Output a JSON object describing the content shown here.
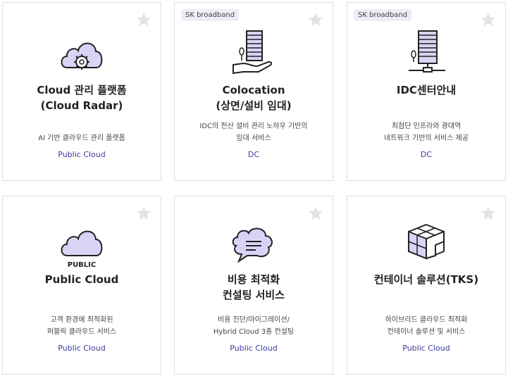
{
  "cards": [
    {
      "badge": "",
      "title": "Cloud 관리 플랫폼\n(Cloud Radar)",
      "desc": "AI 기반 클라우드 관리 플랫폼",
      "category": "Public Cloud",
      "icon": "cloud-gear-icon"
    },
    {
      "badge": "SK broadband",
      "title": "Colocation\n(상면/설비 임대)",
      "desc": "IDC의 전산 설비 관리 노하우 기반의\n임대 서비스",
      "category": "DC",
      "icon": "building-hand-icon"
    },
    {
      "badge": "SK broadband",
      "title": "IDC센터안내",
      "desc": "최첨단 인프라와 광대역\n네트워크 기반의 서비스 제공",
      "category": "DC",
      "icon": "building-network-icon"
    },
    {
      "badge": "",
      "title": "Public Cloud",
      "desc": "고객 환경에 최적화된\n퍼블릭 클라우드 서비스",
      "category": "Public Cloud",
      "icon": "public-cloud-icon",
      "icon_label": "PUBLIC"
    },
    {
      "badge": "",
      "title": "비용 최적화\n컨설팅 서비스",
      "desc": "비용 진단/마이그레이션/\nHybrid Cloud 3종 컨설팅",
      "category": "Public Cloud",
      "icon": "chat-bubble-icon"
    },
    {
      "badge": "",
      "title": "컨테이너 솔루션(TKS)",
      "desc": "하이브리드 클라우드 최적화\n컨테이너 솔루션 및 서비스",
      "category": "Public Cloud",
      "icon": "cubes-icon"
    }
  ],
  "colors": {
    "accent": "#3c3a9c",
    "icon_fill": "#d8d4f5",
    "border": "#dedede"
  }
}
